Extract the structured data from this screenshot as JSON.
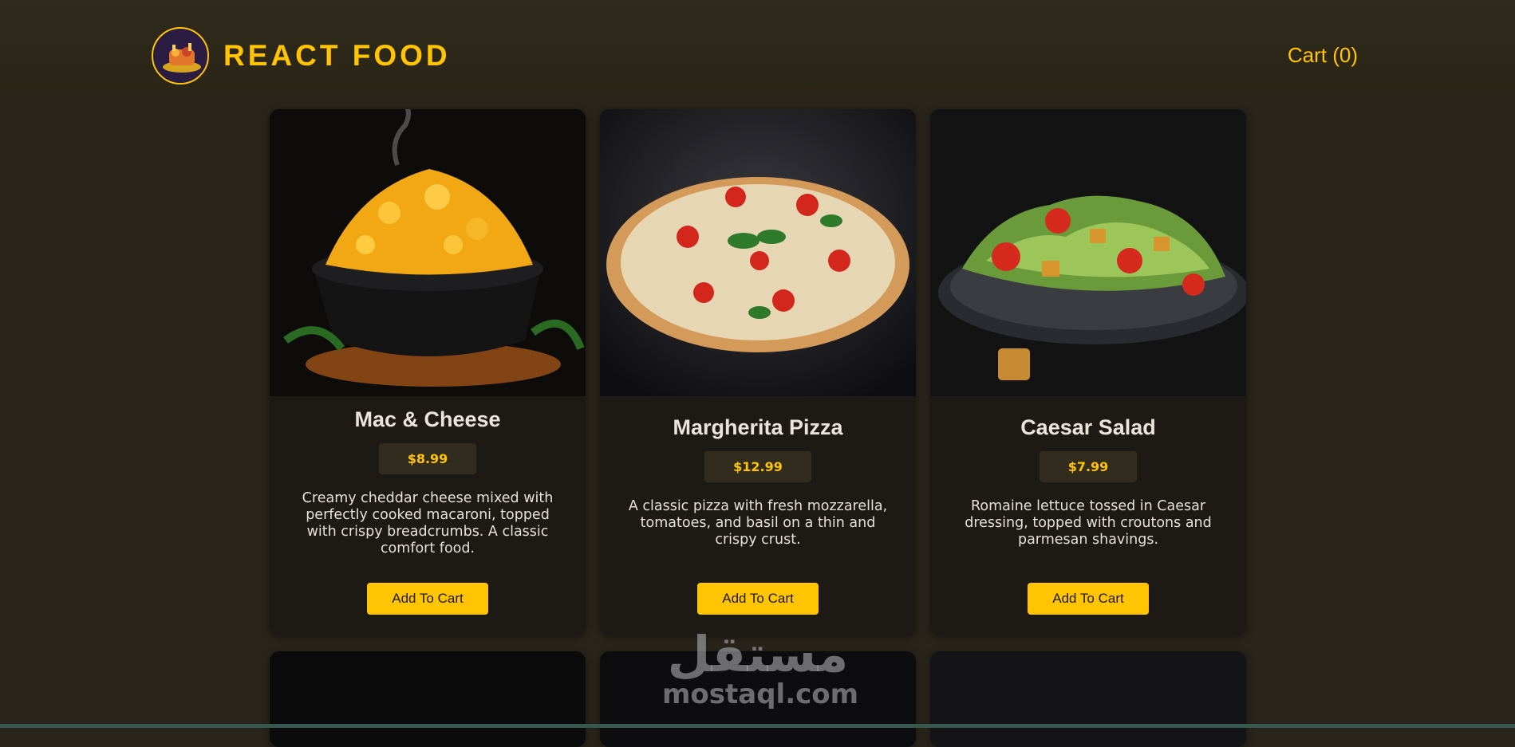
{
  "header": {
    "brand_title": "REACT FOOD",
    "cart_label": "Cart (0)"
  },
  "meals": [
    {
      "title": "Mac & Cheese",
      "price": "$8.99",
      "description": "Creamy cheddar cheese mixed with perfectly cooked macaroni, topped with crispy breadcrumbs. A classic comfort food.",
      "button_label": "Add To Cart"
    },
    {
      "title": "Margherita Pizza",
      "price": "$12.99",
      "description": "A classic pizza with fresh mozzarella, tomatoes, and basil on a thin and crispy crust.",
      "button_label": "Add To Cart"
    },
    {
      "title": "Caesar Salad",
      "price": "$7.99",
      "description": "Romaine lettuce tossed in Caesar dressing, topped with croutons and parmesan shavings.",
      "button_label": "Add To Cart"
    }
  ],
  "watermark": {
    "arabic": "مستقل",
    "latin": "mostaql.com"
  },
  "colors": {
    "accent": "#ffc404",
    "background": "#29251c",
    "card": "#1d1a16"
  }
}
